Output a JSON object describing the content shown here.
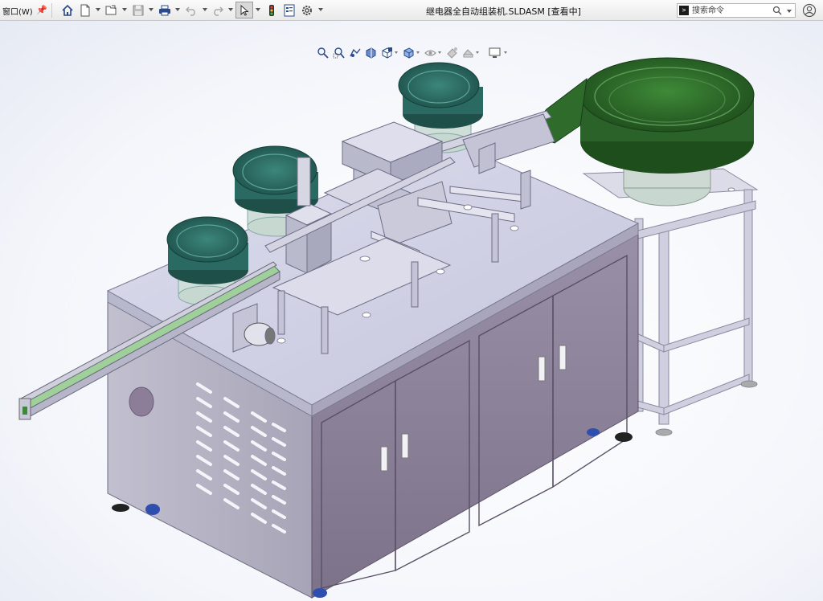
{
  "menu": {
    "window_label": "窗口(W)"
  },
  "document": {
    "title": "继电器全自动组装机.SLDASM [查看中]"
  },
  "search": {
    "placeholder": "搜索命令"
  },
  "toolbar": {
    "icons": [
      "home-icon",
      "new-document-icon",
      "open-icon",
      "save-icon",
      "print-icon",
      "undo-icon",
      "redo-icon",
      "select-arrow-icon",
      "rebuild-traffic-light-icon",
      "file-properties-icon",
      "options-gear-icon"
    ]
  },
  "view_toolbar": {
    "icons": [
      "zoom-to-fit-icon",
      "zoom-to-area-icon",
      "previous-view-icon",
      "section-view-icon",
      "view-orientation-icon",
      "display-style-icon",
      "hide-show-items-icon",
      "edit-appearance-icon",
      "apply-scene-icon",
      "view-settings-icon"
    ]
  },
  "colors": {
    "machine_panel": "#8a8095",
    "machine_side": "#a9a6b8",
    "table_top": "#d4d4e8",
    "bowl_teal": "#2e6e66",
    "bowl_green": "#2d6a2a",
    "frame": "#c9c9db"
  }
}
